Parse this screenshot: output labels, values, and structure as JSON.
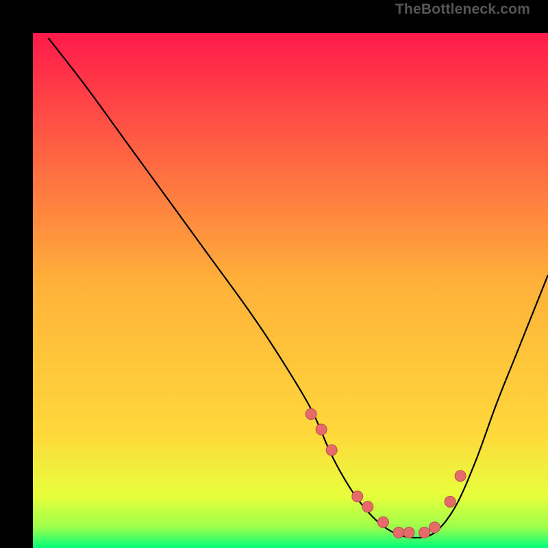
{
  "watermark": "TheBottleneck.com",
  "chart_data": {
    "type": "line",
    "title": "",
    "xlabel": "",
    "ylabel": "",
    "xlim": [
      0,
      100
    ],
    "ylim": [
      0,
      100
    ],
    "grid": false,
    "legend": false,
    "background_gradient": {
      "top_color": "#ff1a4b",
      "mid_color": "#ffd93b",
      "bottom_top_color": "#e6ff3c",
      "bottom_color": "#00ff7b"
    },
    "series": [
      {
        "name": "bottleneck-curve",
        "stroke": "#000000",
        "x": [
          3,
          10,
          18,
          26,
          34,
          42,
          48,
          54,
          58,
          62,
          66,
          70,
          74,
          78,
          82,
          86,
          90,
          94,
          100
        ],
        "y": [
          99,
          90,
          79,
          68,
          57,
          46,
          37,
          27,
          18,
          11,
          6,
          3,
          2,
          3,
          8,
          17,
          28,
          38,
          53
        ]
      }
    ],
    "markers": {
      "name": "highlight-points",
      "fill": "#e66a6a",
      "stroke": "#b84e4e",
      "x": [
        54,
        56,
        58,
        63,
        65,
        68,
        71,
        73,
        76,
        78,
        81,
        83
      ],
      "y": [
        26,
        23,
        19,
        10,
        8,
        5,
        3,
        3,
        3,
        4,
        9,
        14
      ]
    }
  }
}
